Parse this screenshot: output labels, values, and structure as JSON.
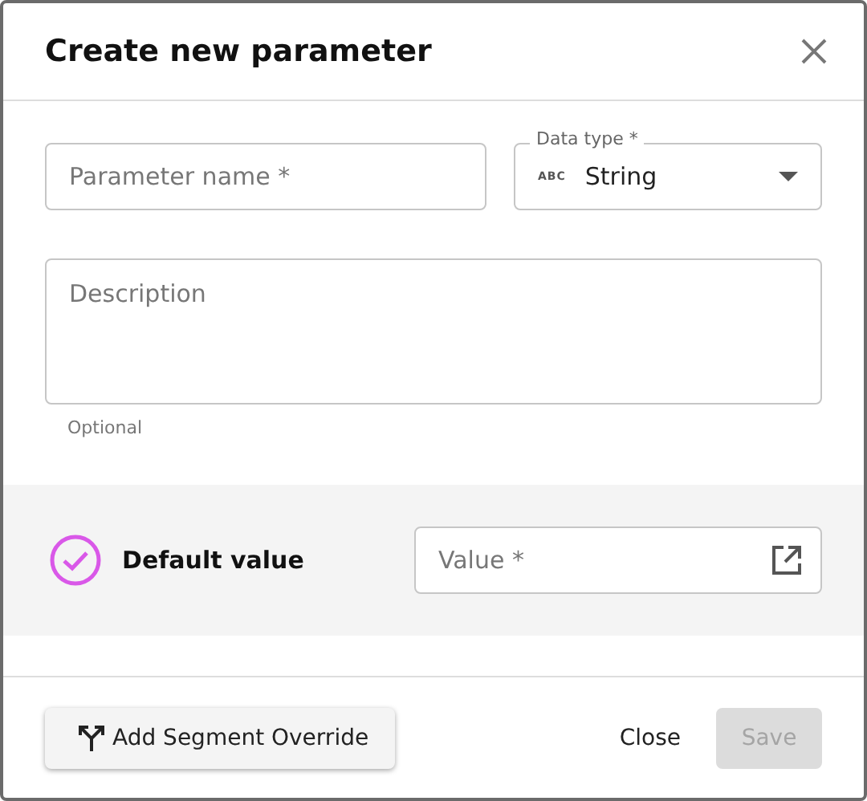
{
  "dialog": {
    "title": "Create new parameter"
  },
  "name_field": {
    "placeholder": "Parameter name *"
  },
  "data_type": {
    "label": "Data type *",
    "badge": "ABC",
    "value": "String"
  },
  "description": {
    "placeholder": "Description",
    "helper": "Optional"
  },
  "default_value": {
    "label": "Default value",
    "checked": true,
    "placeholder": "Value *"
  },
  "footer": {
    "segment_button": "Add Segment Override",
    "close_button": "Close",
    "save_button": {
      "label": "Save",
      "disabled": true
    }
  }
}
